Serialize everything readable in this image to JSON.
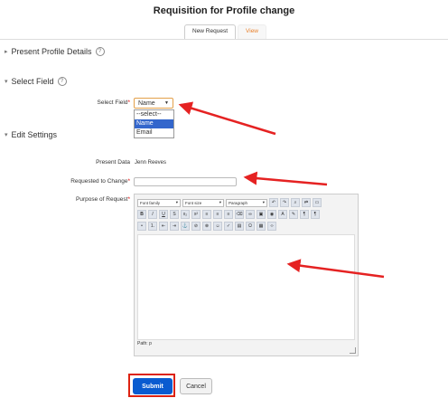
{
  "page": {
    "title": "Requisition for Profile change"
  },
  "tabs": [
    {
      "label": "New Request"
    },
    {
      "label": "View"
    }
  ],
  "sections": {
    "present_profile": "Present Profile Details",
    "select_field": "Select Field",
    "edit_settings": "Edit Settings"
  },
  "form": {
    "select_field_label": "Select Field",
    "select_field_value": "Name",
    "select_options": [
      "--select--",
      "Name",
      "Email"
    ],
    "present_data_label": "Present Data",
    "present_data_value": "Jenn Reeves",
    "requested_label": "Requested to Change",
    "purpose_label": "Purpose of Request",
    "required_mark": "*"
  },
  "editor": {
    "font_family": "Font family",
    "font_size": "Font size",
    "paragraph": "Paragraph",
    "path": "Path: p"
  },
  "buttons": {
    "submit": "Submit",
    "cancel": "Cancel"
  },
  "colors": {
    "accent": "#0a5bd0",
    "tab_inactive": "#e8812c",
    "annotation": "#e52222"
  }
}
